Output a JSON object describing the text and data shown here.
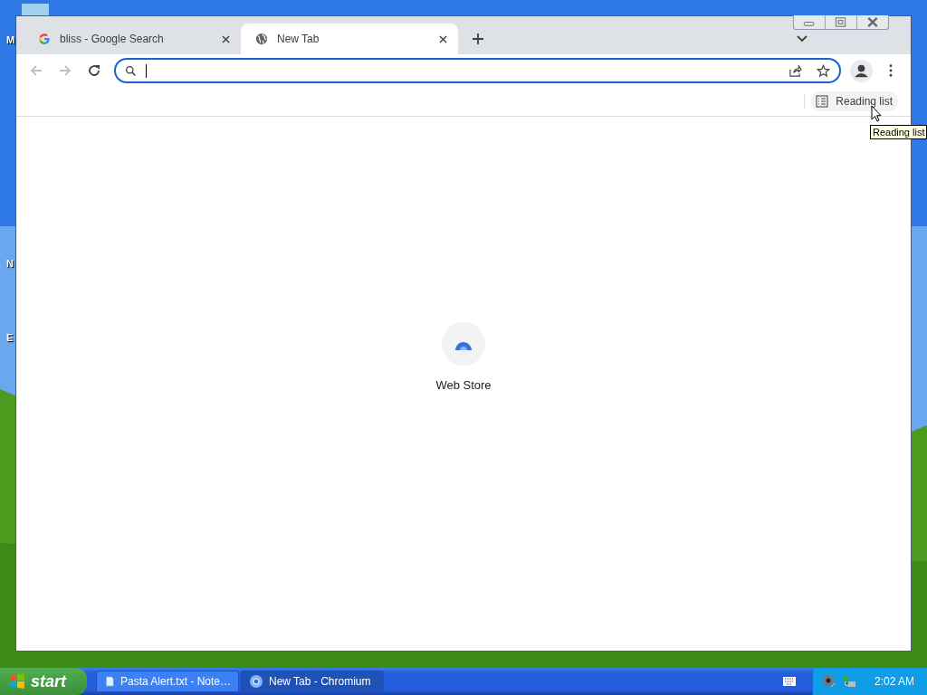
{
  "desktop": {
    "icon_labels": [
      "M",
      "N",
      "E"
    ]
  },
  "browser": {
    "tabs": [
      {
        "title": "bliss - Google Search",
        "kind": "google",
        "selected": false
      },
      {
        "title": "New Tab",
        "kind": "globe",
        "selected": true
      }
    ],
    "bookmarks_bar": {
      "reading_list": "Reading list"
    },
    "tooltip": "Reading list",
    "shortcuts": [
      {
        "title": "Web Store"
      }
    ]
  },
  "taskbar": {
    "start": "start",
    "tasks": [
      {
        "title": "Pasta Alert.txt - Note…",
        "kind": "notepad",
        "selected": false
      },
      {
        "title": "New Tab - Chromium",
        "kind": "chromium",
        "selected": true
      }
    ],
    "clock": "2:02 AM"
  }
}
